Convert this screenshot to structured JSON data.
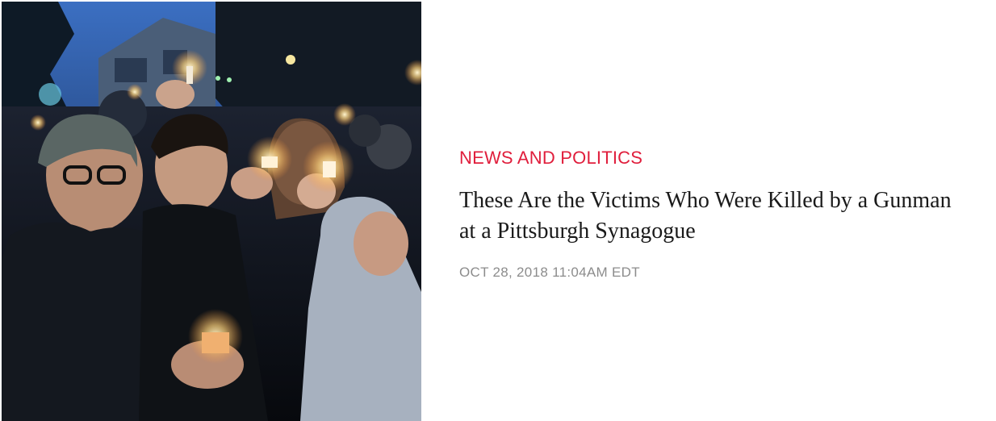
{
  "article": {
    "category": "NEWS AND POLITICS",
    "headline": "These Are the Victims Who Were Killed by a Gunman at a Pittsburgh Synagogue",
    "timestamp": "OCT 28, 2018 11:04AM EDT"
  },
  "colors": {
    "category_accent": "#e01e3c",
    "headline_text": "#1a1a1a",
    "timestamp_text": "#8c8c8c"
  },
  "thumbnail": {
    "icon": "candlelight-vigil-photo"
  }
}
